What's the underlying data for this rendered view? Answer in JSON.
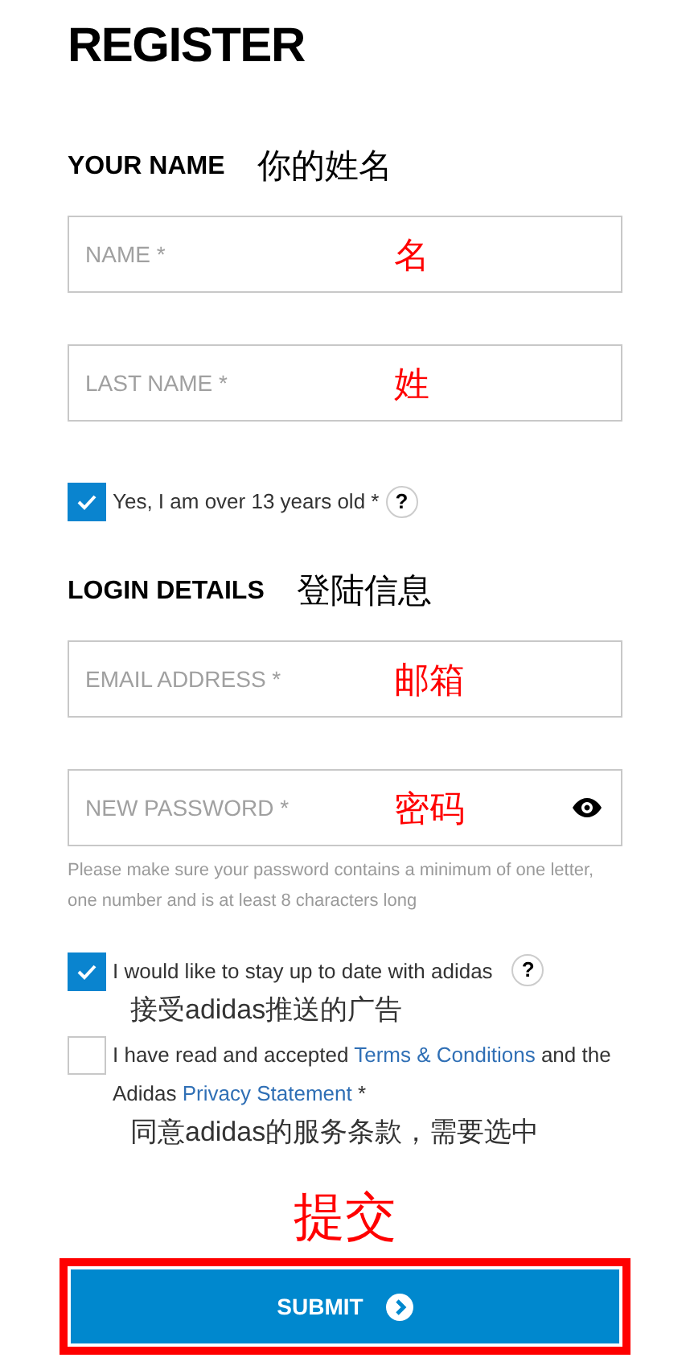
{
  "title": "REGISTER",
  "your_name": {
    "heading": "YOUR NAME",
    "annotation": "你的姓名"
  },
  "name_fields": [
    {
      "placeholder": "NAME *",
      "annotation": "名",
      "password_toggle": false
    },
    {
      "placeholder": "LAST NAME *",
      "annotation": "姓",
      "password_toggle": false
    }
  ],
  "age_check": {
    "label": "Yes, I am over 13 years old *",
    "checked": true,
    "help": "?"
  },
  "login_details": {
    "heading": "LOGIN DETAILS",
    "annotation": "登陆信息"
  },
  "login_fields": [
    {
      "placeholder": "EMAIL ADDRESS *",
      "annotation": "邮箱",
      "password_toggle": false
    },
    {
      "placeholder": "NEW PASSWORD *",
      "annotation": "密码",
      "password_toggle": true
    }
  ],
  "password_hint": "Please make sure your password contains a minimum of one letter, one number and is at least 8 characters long",
  "consents": [
    {
      "checked": true,
      "help": "?",
      "segments": [
        {
          "kind": "text",
          "text": "I would like to stay up to date with adidas"
        }
      ],
      "annotation": "接受adidas推送的广告"
    },
    {
      "checked": false,
      "segments": [
        {
          "kind": "text",
          "text": "I have read and accepted"
        },
        {
          "kind": "link",
          "text": "Terms & Conditions"
        },
        {
          "kind": "text",
          "text": "and the Adidas"
        },
        {
          "kind": "link",
          "text": "Privacy Statement"
        },
        {
          "kind": "text",
          "text": "*"
        }
      ],
      "annotation": "同意adidas的服务条款，需要选中"
    }
  ],
  "submit": {
    "annotation": "提交",
    "label": "SUBMIT",
    "highlighted": true
  }
}
